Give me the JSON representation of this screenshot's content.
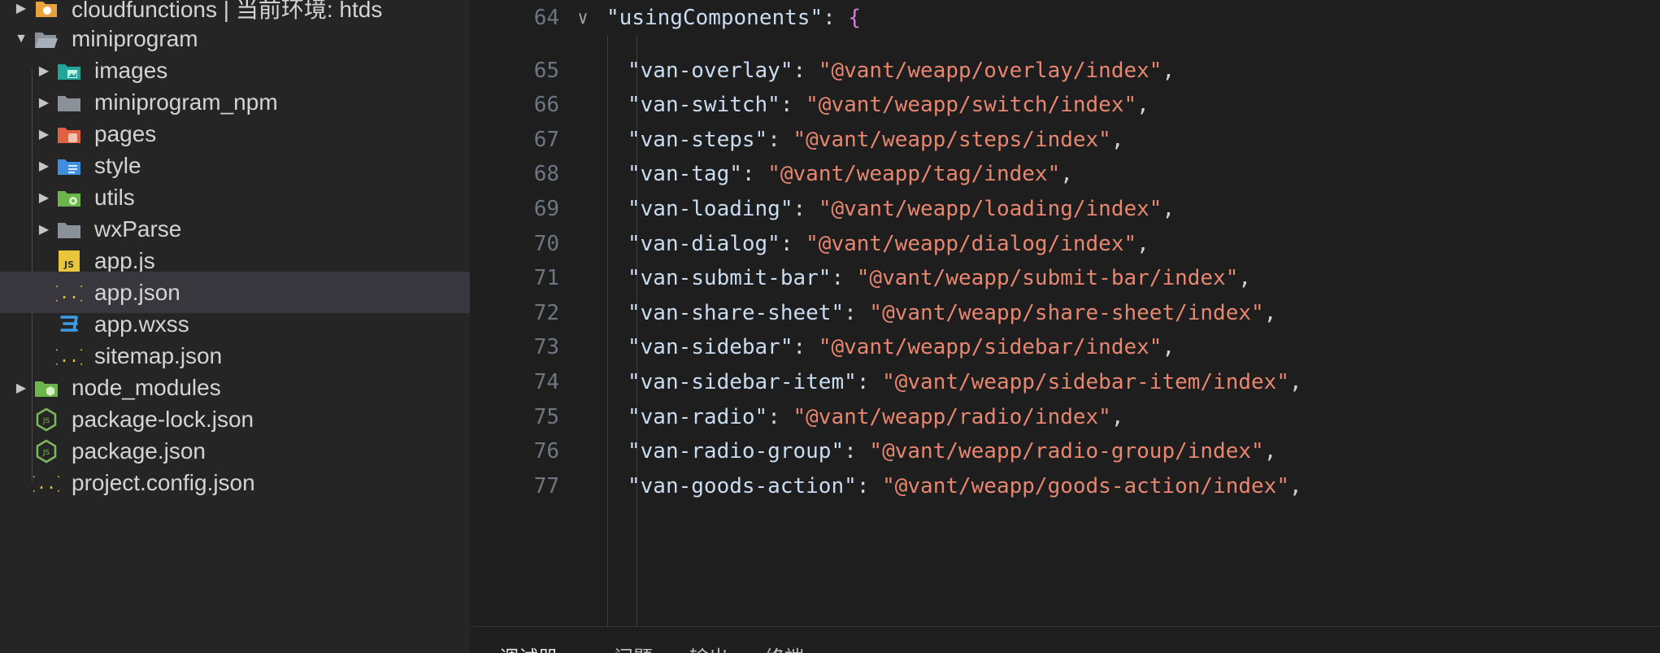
{
  "explorer": {
    "items": [
      {
        "label": "cloudfunctions | 当前环境: htds",
        "icon": "cloud-folder-icon",
        "expanded": false
      },
      {
        "label": "miniprogram",
        "icon": "folder-open-icon",
        "expanded": true
      },
      {
        "label": "images",
        "icon": "images-folder-icon",
        "expanded": false
      },
      {
        "label": "miniprogram_npm",
        "icon": "folder-icon",
        "expanded": false
      },
      {
        "label": "pages",
        "icon": "pages-folder-icon",
        "expanded": false
      },
      {
        "label": "style",
        "icon": "style-folder-icon",
        "expanded": false
      },
      {
        "label": "utils",
        "icon": "utils-folder-icon",
        "expanded": false
      },
      {
        "label": "wxParse",
        "icon": "folder-icon",
        "expanded": false
      },
      {
        "label": "app.js",
        "icon": "js-file-icon",
        "badge": "JS"
      },
      {
        "label": "app.json",
        "icon": "json-file-icon",
        "badge": "{..}",
        "selected": true
      },
      {
        "label": "app.wxss",
        "icon": "css-file-icon",
        "badge": "3"
      },
      {
        "label": "sitemap.json",
        "icon": "json-file-icon",
        "badge": "{..}"
      },
      {
        "label": "node_modules",
        "icon": "node-folder-icon",
        "expanded": false
      },
      {
        "label": "package-lock.json",
        "icon": "node-file-icon"
      },
      {
        "label": "package.json",
        "icon": "node-file-icon"
      },
      {
        "label": "project.config.json",
        "icon": "json-file-icon",
        "badge": "{..}"
      }
    ]
  },
  "editor": {
    "fold_marker": "∨",
    "lines": [
      {
        "num": "64",
        "key": "\"usingComponents\"",
        "sep": ": ",
        "value": "",
        "tail": "{",
        "folded": true
      },
      {
        "num": "65",
        "key": "\"van-overlay\"",
        "sep": ": ",
        "value": "\"@vant/weapp/overlay/index\"",
        "tail": ","
      },
      {
        "num": "66",
        "key": "\"van-switch\"",
        "sep": ": ",
        "value": "\"@vant/weapp/switch/index\"",
        "tail": ","
      },
      {
        "num": "67",
        "key": "\"van-steps\"",
        "sep": ": ",
        "value": "\"@vant/weapp/steps/index\"",
        "tail": ","
      },
      {
        "num": "68",
        "key": "\"van-tag\"",
        "sep": ": ",
        "value": "\"@vant/weapp/tag/index\"",
        "tail": ","
      },
      {
        "num": "69",
        "key": "\"van-loading\"",
        "sep": ": ",
        "value": "\"@vant/weapp/loading/index\"",
        "tail": ","
      },
      {
        "num": "70",
        "key": "\"van-dialog\"",
        "sep": ": ",
        "value": "\"@vant/weapp/dialog/index\"",
        "tail": ","
      },
      {
        "num": "71",
        "key": "\"van-submit-bar\"",
        "sep": ": ",
        "value": "\"@vant/weapp/submit-bar/index\"",
        "tail": ","
      },
      {
        "num": "72",
        "key": "\"van-share-sheet\"",
        "sep": ": ",
        "value": "\"@vant/weapp/share-sheet/index\"",
        "tail": ","
      },
      {
        "num": "73",
        "key": "\"van-sidebar\"",
        "sep": ": ",
        "value": "\"@vant/weapp/sidebar/index\"",
        "tail": ","
      },
      {
        "num": "74",
        "key": "\"van-sidebar-item\"",
        "sep": ": ",
        "value": "\"@vant/weapp/sidebar-item/index\"",
        "tail": ","
      },
      {
        "num": "75",
        "key": "\"van-radio\"",
        "sep": ": ",
        "value": "\"@vant/weapp/radio/index\"",
        "tail": ","
      },
      {
        "num": "76",
        "key": "\"van-radio-group\"",
        "sep": ": ",
        "value": "\"@vant/weapp/radio-group/index\"",
        "tail": ","
      },
      {
        "num": "77",
        "key": "\"van-goods-action\"",
        "sep": ": ",
        "value": "\"@vant/weapp/goods-action/index\"",
        "tail": ","
      }
    ]
  },
  "panel": {
    "tabs": [
      "调试器",
      "问题",
      "输出",
      "终端"
    ]
  },
  "colors": {
    "sidebar_bg": "#252526",
    "editor_bg": "#1e1e1e",
    "selection": "#37373d",
    "json_key": "#c9dcf0",
    "json_string": "#e8866f",
    "brace": "#d77fd8"
  }
}
